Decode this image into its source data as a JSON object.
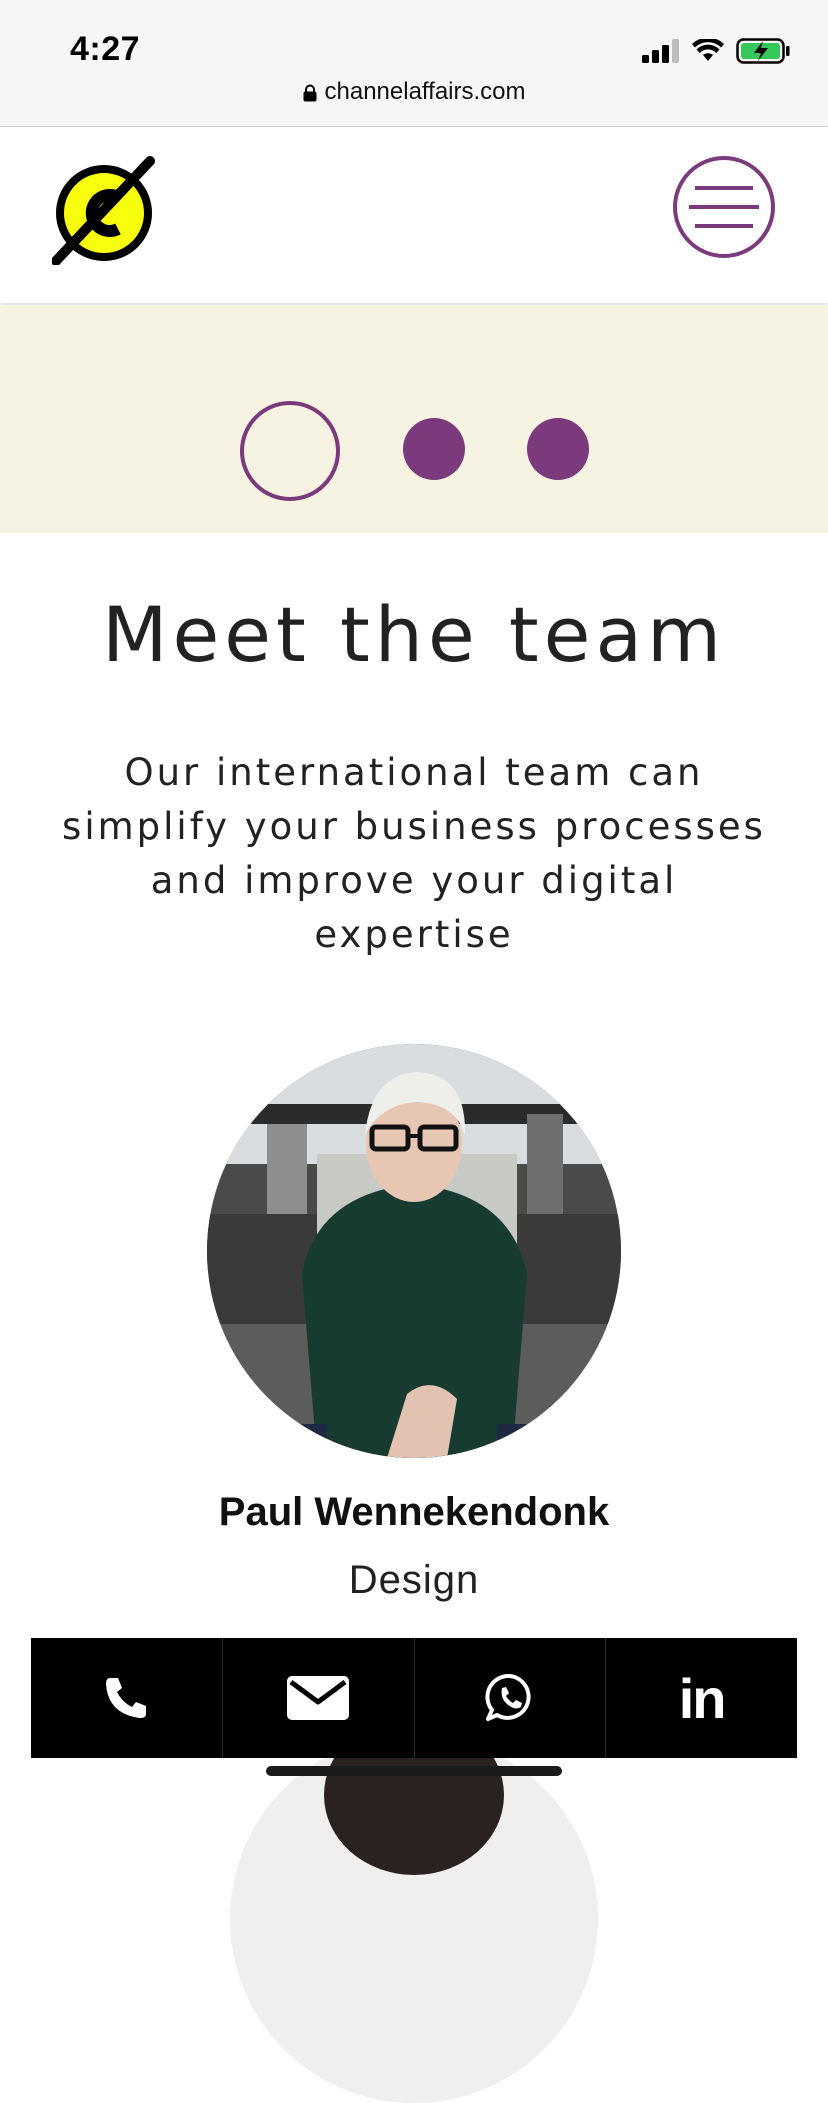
{
  "status_bar": {
    "time": "4:27",
    "url": "channelaffairs.com"
  },
  "header": {
    "logo_letter": "C",
    "logo_color": "#f7ff0c",
    "menu_icon": "hamburger-menu-icon",
    "accent_color": "#7b3a7c"
  },
  "carousel": {
    "active_index": 0,
    "dots": 3
  },
  "main": {
    "title": "Meet the team",
    "subtitle_lines": [
      "Our international team can",
      "simplify your business processes",
      "and improve your digital",
      "expertise"
    ]
  },
  "member": {
    "name": "Paul Wennekendonk",
    "role": "Design"
  },
  "contact_bar": {
    "items": [
      "phone-icon",
      "mail-icon",
      "whatsapp-icon",
      "linkedin-icon"
    ],
    "linkedin_text": "in"
  }
}
